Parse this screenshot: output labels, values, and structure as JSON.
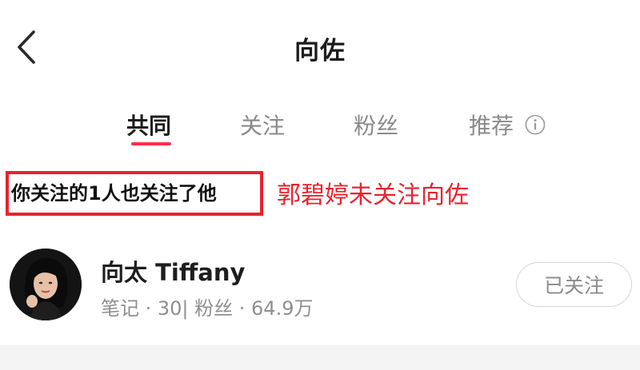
{
  "header": {
    "title": "向佐",
    "back_icon": "chevron-left-icon"
  },
  "tabs": [
    {
      "label": "共同",
      "active": true
    },
    {
      "label": "关注",
      "active": false
    },
    {
      "label": "粉丝",
      "active": false
    },
    {
      "label": "推荐",
      "active": false
    }
  ],
  "tabs_info_icon": "info-circle-icon",
  "accent_color": "#ff2d4a",
  "common_follow": {
    "text": "你关注的1人也关注了他"
  },
  "annotation": {
    "text": "郭碧婷未关注向佐",
    "color": "#e8232d"
  },
  "users": [
    {
      "name": "向太 Tiffany",
      "stats": "笔记 · 30| 粉丝 · 64.9万",
      "follow_label": "已关注",
      "avatar": "avatar-photo"
    }
  ]
}
